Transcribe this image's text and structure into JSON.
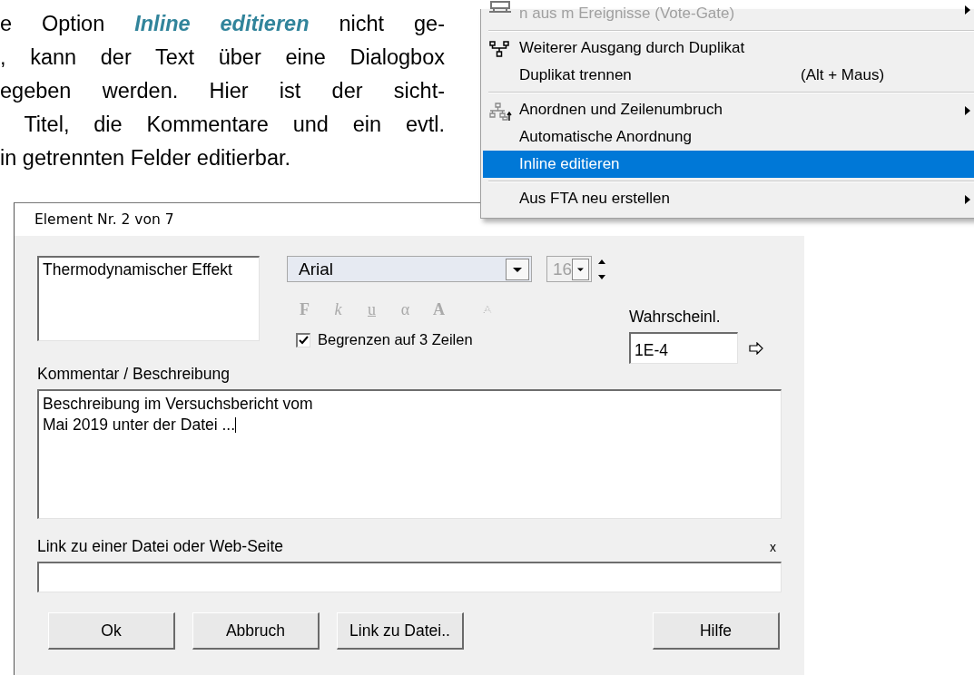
{
  "paragraph": {
    "lines": [
      "e Option **Inline editieren** nicht ge-",
      ", kann der Text über eine Dialogbox",
      "egeben werden. Hier ist der sicht-",
      " Titel, die Kommentare und ein evtl.",
      "in getrennten Felder editierbar."
    ]
  },
  "context_menu": {
    "items": [
      {
        "kind": "item",
        "label": "n aus m Ereignisse (Vote-Gate)",
        "disabled": true,
        "submenu": true,
        "selected": false
      },
      {
        "kind": "separator"
      },
      {
        "kind": "item",
        "label": "Weiterer Ausgang durch Duplikat",
        "disabled": false,
        "submenu": false,
        "selected": false
      },
      {
        "kind": "item",
        "label": "Duplikat trennen",
        "shortcut": "(Alt + Maus)",
        "disabled": false,
        "submenu": false,
        "selected": false
      },
      {
        "kind": "separator"
      },
      {
        "kind": "item",
        "label": "Anordnen und Zeilenumbruch",
        "disabled": false,
        "submenu": true,
        "selected": false
      },
      {
        "kind": "item",
        "label": "Automatische Anordnung",
        "disabled": false,
        "submenu": false,
        "selected": false
      },
      {
        "kind": "item",
        "label": "Inline editieren",
        "disabled": false,
        "submenu": false,
        "selected": true
      },
      {
        "kind": "separator"
      },
      {
        "kind": "item",
        "label": "Aus FTA neu erstellen",
        "disabled": false,
        "submenu": true,
        "selected": false
      }
    ]
  },
  "dialog": {
    "title": "Element Nr. 2 von 7",
    "title_field": {
      "value": "Thermodynamischer Effekt"
    },
    "font_select": {
      "value": "Arial"
    },
    "size_select": {
      "value": "16",
      "disabled": true
    },
    "format_buttons": [
      {
        "kind": "bold",
        "label": "F",
        "disabled": true
      },
      {
        "kind": "italic",
        "label": "k",
        "disabled": true
      },
      {
        "kind": "underline",
        "label": "u",
        "disabled": true
      },
      {
        "kind": "symbol",
        "label": "α",
        "disabled": true
      },
      {
        "kind": "size",
        "label": "A",
        "disabled": true
      },
      {
        "kind": "dotted",
        "disabled": true
      }
    ],
    "limit_checkbox": {
      "label": "Begrenzen auf 3 Zeilen",
      "checked": true
    },
    "probability": {
      "label": "Wahrscheinl.",
      "value": "1E-4"
    },
    "comment": {
      "label": "Kommentar / Beschreibung",
      "value": "Beschreibung im Versuchsbericht vom\nMai 2019 unter der Datei ..."
    },
    "link": {
      "label": "Link zu einer Datei oder Web-Seite",
      "clear": "x"
    },
    "buttons": [
      {
        "kind": "left",
        "label": "Ok"
      },
      {
        "kind": "left",
        "label": "Abbruch"
      },
      {
        "kind": "left",
        "label": "Link zu Datei.."
      },
      {
        "kind": "right",
        "label": "Hilfe"
      }
    ]
  }
}
